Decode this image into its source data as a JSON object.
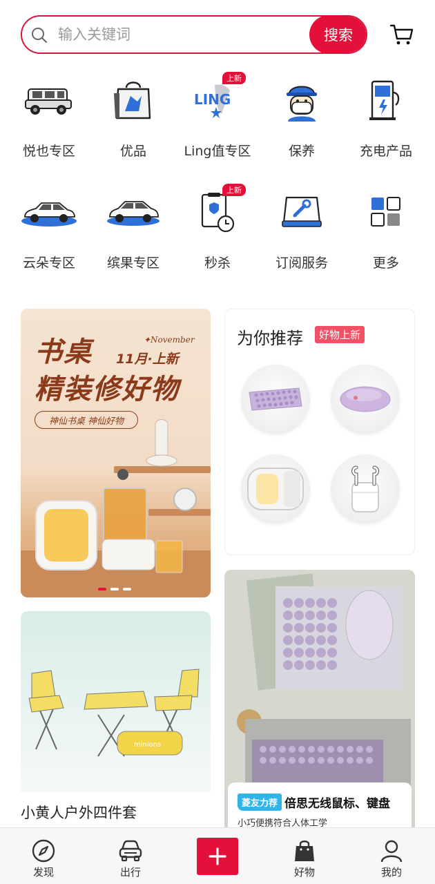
{
  "search": {
    "placeholder": "输入关键词",
    "button_label": "搜索"
  },
  "header": {
    "cart_icon": "cart-icon"
  },
  "categories": [
    {
      "label": "悦也专区",
      "icon": "suv-icon"
    },
    {
      "label": "优品",
      "icon": "shopping-bag-icon"
    },
    {
      "label": "Ling值专区",
      "icon": "ling-logo-icon",
      "badge": "上新"
    },
    {
      "label": "保养",
      "icon": "mechanic-icon"
    },
    {
      "label": "充电产品",
      "icon": "charger-icon"
    },
    {
      "label": "云朵专区",
      "icon": "cloud-car-icon"
    },
    {
      "label": "缤果专区",
      "icon": "bingo-car-icon"
    },
    {
      "label": "秒杀",
      "icon": "flash-sale-icon",
      "badge": "上新"
    },
    {
      "label": "订阅服务",
      "icon": "subscription-tools-icon"
    },
    {
      "label": "更多",
      "icon": "grid-more-icon"
    }
  ],
  "banner": {
    "title_line1": "书桌",
    "title_line2": "精装修好物",
    "november": "✦November",
    "month_label": "11月·上新",
    "pill_text": "神仙书桌 神仙好物",
    "active_slide": 1,
    "slide_count": 3
  },
  "recommend": {
    "title": "为你推荐",
    "badge": "好物上新",
    "items": [
      {
        "icon": "keyboard-icon"
      },
      {
        "icon": "mouse-icon"
      },
      {
        "icon": "night-lamp-icon"
      },
      {
        "icon": "earbuds-icon"
      }
    ]
  },
  "product_left": {
    "name": "小黄人户外四件套",
    "bag_text": "minions"
  },
  "product_right": {
    "tag": "菱友力荐",
    "title": "倍思无线鼠标、键盘",
    "subtitle": "小巧便携符合人体工学"
  },
  "tabbar": [
    {
      "label": "发现",
      "icon": "compass-icon"
    },
    {
      "label": "出行",
      "icon": "car-front-icon"
    },
    {
      "label": "",
      "icon": "plus-icon"
    },
    {
      "label": "好物",
      "icon": "bag-icon"
    },
    {
      "label": "我的",
      "icon": "user-icon"
    }
  ],
  "colors": {
    "accent": "#e4103a",
    "banner_text": "#8b3b1b",
    "tag_blue": "#2fb3e8"
  }
}
